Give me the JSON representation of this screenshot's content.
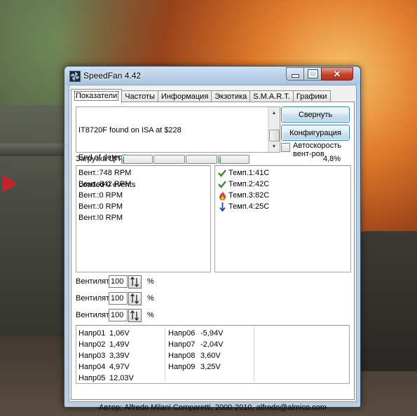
{
  "window": {
    "title": "SpeedFan 4.42",
    "close_glyph": "✕"
  },
  "tabs": [
    "Показатели",
    "Частоты",
    "Информация",
    "Экзотика",
    "S.M.A.R.T.",
    "Графики"
  ],
  "log": {
    "lines": [
      "IT8720F found on ISA at $228",
      "End of detection",
      "Loaded 0 events"
    ]
  },
  "buttons": {
    "minimize": "Свернуть",
    "config": "Конфигурация"
  },
  "autospeed": {
    "label": "Автоскорость вент-ров",
    "checked": false
  },
  "cpu": {
    "label": "Загрузка ЦП",
    "value": "4,8%",
    "core_fractions": [
      0.03,
      0.0,
      0.0,
      0.02
    ]
  },
  "fans": [
    "Вент.:748 RPM",
    "Вент.:842 RPM",
    "Вент.:0 RPM",
    "Вент.:0 RPM",
    "Вент.!0 RPM"
  ],
  "temps": [
    {
      "label": "Темп.1:41C",
      "icon": "check-icon",
      "color": "#2a8a1f"
    },
    {
      "label": "Темп.2:42C",
      "icon": "check-icon",
      "color": "#2a8a1f"
    },
    {
      "label": "Темп.3:82C",
      "icon": "flame-icon",
      "color": "#e0401c"
    },
    {
      "label": "Темп.4:25C",
      "icon": "arrow-down-icon",
      "color": "#1a40c8"
    }
  ],
  "speeds": [
    {
      "label": "Вентилят",
      "value": "100",
      "unit": "%"
    },
    {
      "label": "Вентилят",
      "value": "100",
      "unit": "%"
    },
    {
      "label": "Вентилят",
      "value": "100",
      "unit": "%"
    }
  ],
  "voltages_left": [
    {
      "name": "Напр01",
      "value": "1,06V"
    },
    {
      "name": "Напр02",
      "value": "1,49V"
    },
    {
      "name": "Напр03",
      "value": "3,39V"
    },
    {
      "name": "Напр04",
      "value": "4,97V"
    },
    {
      "name": "Напр05",
      "value": "12,03V"
    }
  ],
  "voltages_right": [
    {
      "name": "Напр06",
      "value": "-5,94V"
    },
    {
      "name": "Напр07",
      "value": "-2,04V"
    },
    {
      "name": "Напр08",
      "value": "3,60V"
    },
    {
      "name": "Напр09",
      "value": "3,25V"
    }
  ],
  "status": "Автор: Alfredo Milani Comparetti, 2000-2010, alfredo@almico.com"
}
